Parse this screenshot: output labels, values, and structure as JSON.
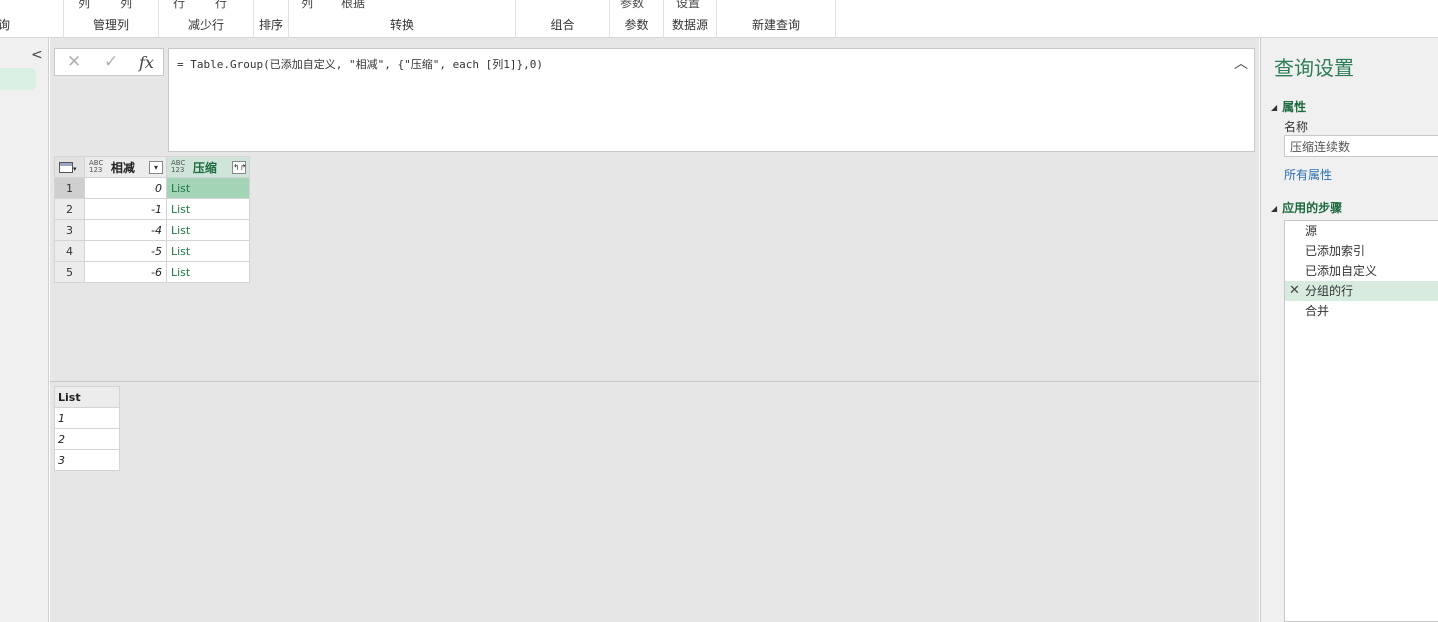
{
  "ribbon": {
    "groups": [
      {
        "label": "询",
        "frags": []
      },
      {
        "label": "管理列",
        "frags": [
          "列",
          "列"
        ]
      },
      {
        "label": "减少行",
        "frags": [
          "行",
          "行"
        ]
      },
      {
        "label": "排序",
        "frags": []
      },
      {
        "label": "转换",
        "frags": [
          "列",
          "根据"
        ]
      },
      {
        "label": "组合",
        "frags": []
      },
      {
        "label": "参数",
        "frags": [
          "参数"
        ]
      },
      {
        "label": "数据源",
        "frags": [
          "设置"
        ]
      },
      {
        "label": "新建查询",
        "frags": []
      }
    ]
  },
  "formula_bar": {
    "cancel_icon": "✕",
    "confirm_icon": "✓",
    "fx_label": "fx",
    "text": "= Table.Group(已添加自定义, \"相减\", {\"压缩\", each [列1]},0)"
  },
  "grid": {
    "corner_icon": "table-icon",
    "type_label": "ABC\n123",
    "columns": [
      {
        "name": "相减",
        "button": "▾"
      },
      {
        "name": "压缩",
        "button": "↰↱"
      }
    ],
    "rows": [
      {
        "index": "1",
        "diff": "0",
        "packed": "List"
      },
      {
        "index": "2",
        "diff": "-1",
        "packed": "List"
      },
      {
        "index": "3",
        "diff": "-4",
        "packed": "List"
      },
      {
        "index": "4",
        "diff": "-5",
        "packed": "List"
      },
      {
        "index": "5",
        "diff": "-6",
        "packed": "List"
      }
    ]
  },
  "preview": {
    "header": "List",
    "values": [
      "1",
      "2",
      "3"
    ]
  },
  "query_settings": {
    "title": "查询设置",
    "properties_header": "属性",
    "name_label": "名称",
    "name_value": "压缩连续数",
    "all_properties": "所有属性",
    "steps_header": "应用的步骤",
    "steps": [
      "源",
      "已添加索引",
      "已添加自定义",
      "分组的行",
      "合并"
    ],
    "selected_step": 3
  },
  "colors": {
    "accent_green": "#2f7d57",
    "selected_cell": "#a3d4b6",
    "selected_step": "#d7ecdf",
    "link_blue": "#2a6fb0"
  }
}
